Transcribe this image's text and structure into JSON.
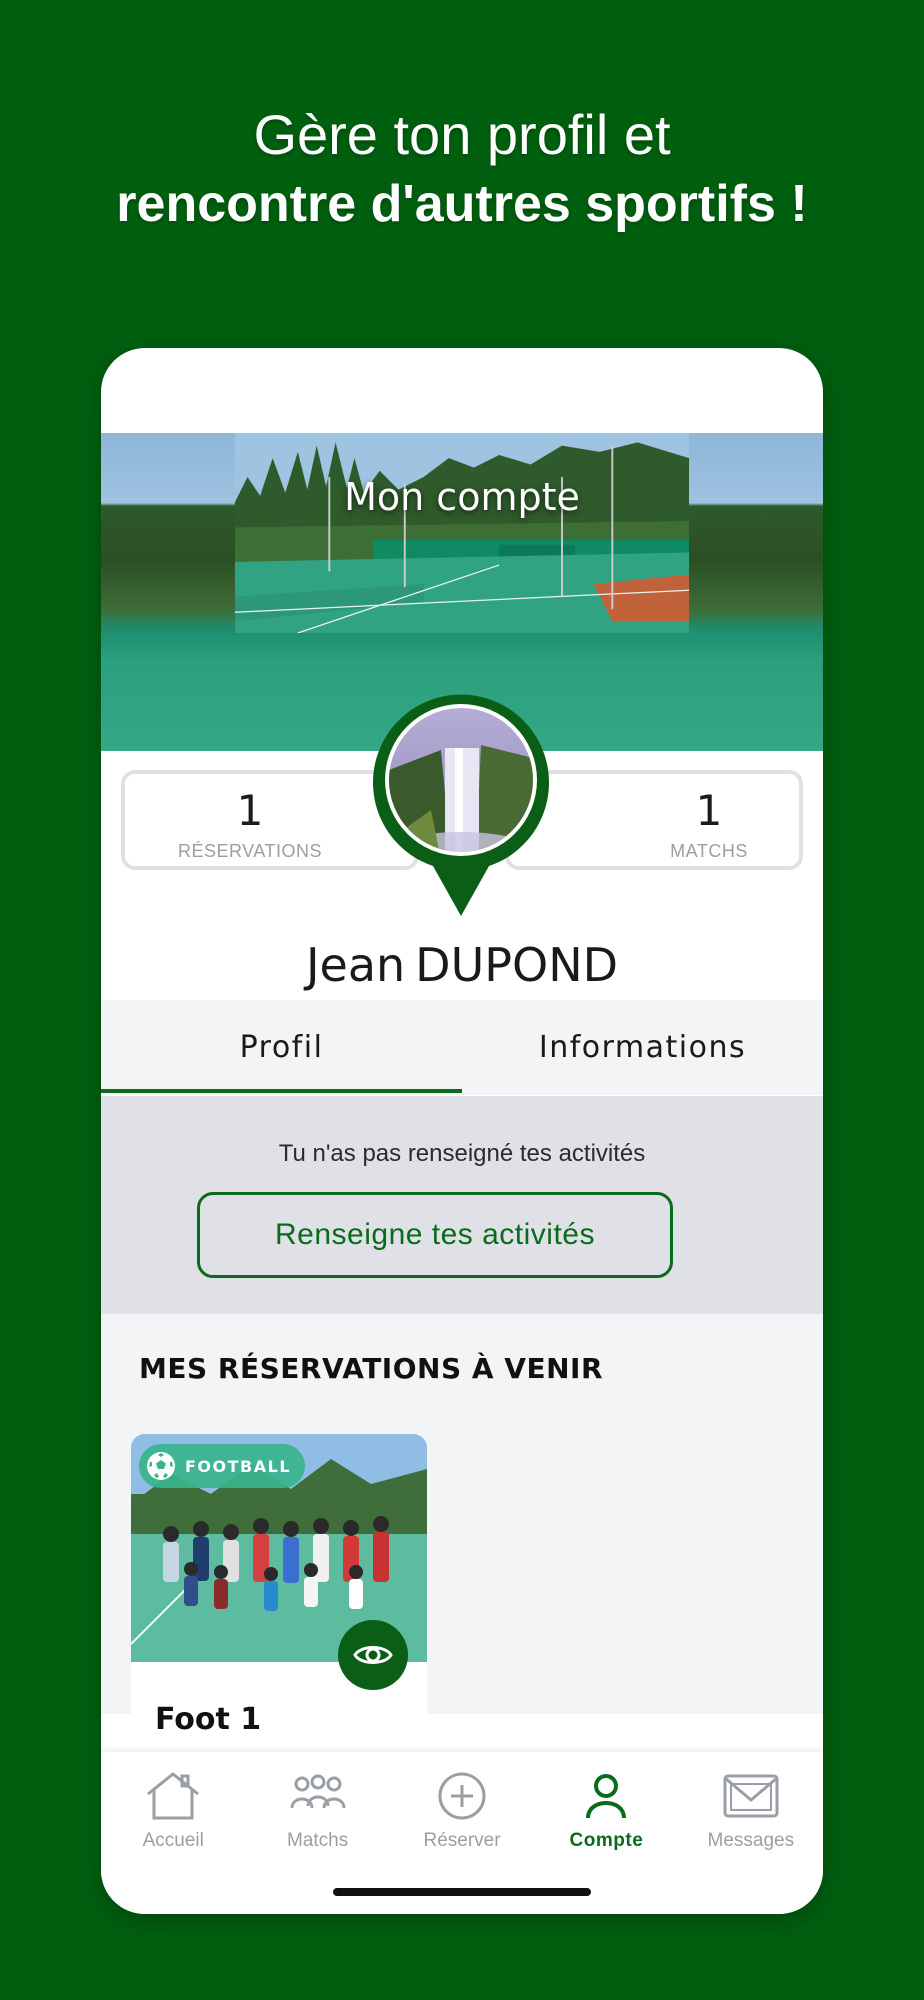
{
  "headline": {
    "line1": "Gère ton profil et",
    "line2": "rencontre d'autres sportifs !"
  },
  "header": {
    "title": "Mon compte"
  },
  "stats": {
    "reservations": {
      "value": "1",
      "label": "RÉSERVATIONS"
    },
    "matches": {
      "value": "1",
      "label": "MATCHS"
    }
  },
  "user": {
    "first_name": "Jean",
    "last_name": "DUPOND"
  },
  "tabs": [
    {
      "label": "Profil",
      "active": true
    },
    {
      "label": "Informations",
      "active": false
    }
  ],
  "activities": {
    "message": "Tu n'as pas renseigné tes activités",
    "button_label": "Renseigne tes activités"
  },
  "reservations": {
    "section_title": "MES RÉSERVATIONS À VENIR",
    "cards": [
      {
        "sport": "FOOTBALL",
        "title": "Foot 1",
        "icon": "soccer-ball-icon"
      }
    ]
  },
  "nav": [
    {
      "label": "Accueil",
      "icon": "home-icon",
      "active": false
    },
    {
      "label": "Matchs",
      "icon": "people-icon",
      "active": false
    },
    {
      "label": "Réserver",
      "icon": "plus-circle-icon",
      "active": false
    },
    {
      "label": "Compte",
      "icon": "user-icon",
      "active": true
    },
    {
      "label": "Messages",
      "icon": "envelope-icon",
      "active": false
    }
  ],
  "colors": {
    "background": "#005f0f",
    "accent": "#0a6b1c",
    "badge": "#3ab48c"
  }
}
